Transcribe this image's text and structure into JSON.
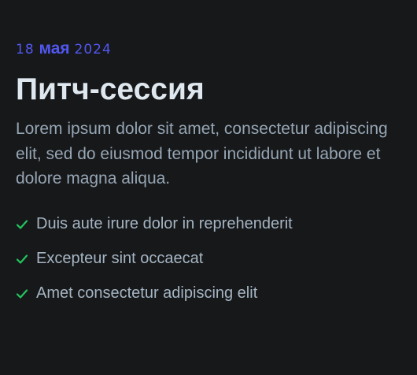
{
  "date": {
    "day": "18",
    "month": "мая",
    "year": "2024"
  },
  "title": "Питч-сессия",
  "description": "Lorem ipsum dolor sit amet, consectetur adipiscing elit, sed do eiusmod tempor incididunt ut labore et dolore magna aliqua.",
  "features": [
    {
      "icon": "check-icon",
      "label": "Duis aute irure dolor in reprehenderit"
    },
    {
      "icon": "check-icon",
      "label": "Excepteur sint occaecat"
    },
    {
      "icon": "check-icon",
      "label": "Amet consectetur adipiscing elit"
    }
  ],
  "colors": {
    "accent": "#5157f0",
    "check": "#22c55e",
    "background": "#17181a"
  }
}
